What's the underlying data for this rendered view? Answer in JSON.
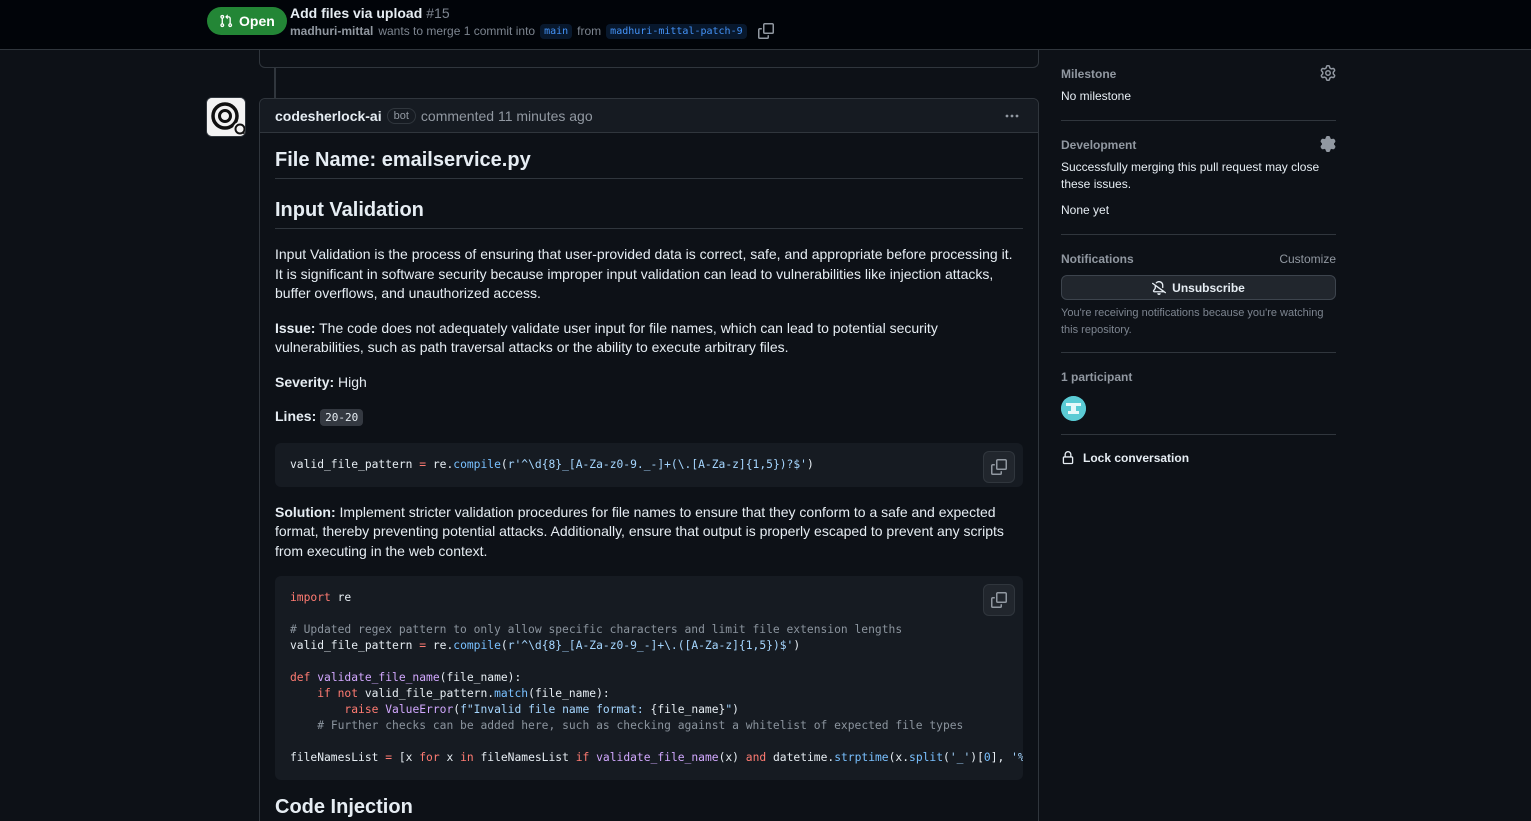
{
  "header": {
    "state": "Open",
    "title": "Add files via upload",
    "number": "#15",
    "author": "madhuri-mittal",
    "merge_text": "wants to merge 1 commit into",
    "base_branch": "main",
    "from_text": "from",
    "head_branch": "madhuri-mittal-patch-9"
  },
  "comment": {
    "author": "codesherlock-ai",
    "badge": "bot",
    "meta": "commented 11 minutes ago",
    "file_heading": "File Name: emailservice.py",
    "section_heading": "Input Validation",
    "intro": "Input Validation is the process of ensuring that user-provided data is correct, safe, and appropriate before processing it. It is significant in software security because improper input validation can lead to vulnerabilities like injection attacks, buffer overflows, and unauthorized access.",
    "issue_label": "Issue:",
    "issue_text": "The code does not adequately validate user input for file names, which can lead to potential security vulnerabilities, such as path traversal attacks or the ability to execute arbitrary files.",
    "severity_label": "Severity:",
    "severity_value": "High",
    "lines_label": "Lines:",
    "lines_value": "20-20",
    "solution_label": "Solution:",
    "solution_text": "Implement stricter validation procedures for file names to ensure that they conform to a safe and expected format, thereby preventing potential attacks. Additionally, ensure that output is properly escaped to prevent any scripts from executing in the web context.",
    "next_heading": "Code Injection"
  },
  "sidebar": {
    "milestone_heading": "Milestone",
    "milestone_value": "No milestone",
    "development_heading": "Development",
    "development_text": "Successfully merging this pull request may close these issues.",
    "development_value": "None yet",
    "notifications_heading": "Notifications",
    "customize_label": "Customize",
    "unsubscribe_label": "Unsubscribe",
    "notifications_reason": "You're receiving notifications because you're watching this repository.",
    "participants_heading": "1 participant",
    "lock_label": "Lock conversation"
  },
  "colors": {
    "open_badge": "#238636",
    "background": "#0d1117",
    "link_blue": "#4493f8"
  },
  "icons": {
    "state": "git-pull-request-icon",
    "copy": "copy-icon",
    "gear": "gear-icon",
    "bell": "bell-slash-icon",
    "lock": "lock-icon",
    "kebab": "kebab-horizontal-icon"
  }
}
